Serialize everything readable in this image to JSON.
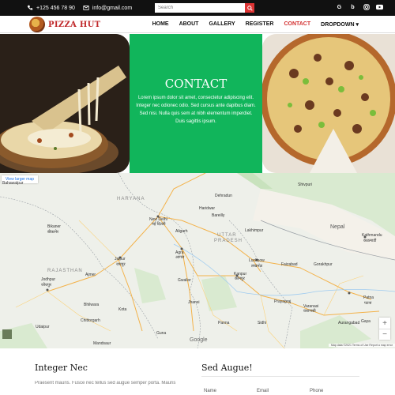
{
  "topbar": {
    "phone": "+125 456 78 90",
    "email": "info@gmail.com",
    "search_placeholder": "Search",
    "social": [
      "G",
      "b",
      "in",
      "yt"
    ]
  },
  "nav": {
    "brand": "PIZZA HUT",
    "items": [
      {
        "label": "HOME",
        "active": false
      },
      {
        "label": "ABOUT",
        "active": false
      },
      {
        "label": "GALLERY",
        "active": false
      },
      {
        "label": "REGISTER",
        "active": false
      },
      {
        "label": "CONTACT",
        "active": true
      },
      {
        "label": "DROPDOWN",
        "active": false
      }
    ]
  },
  "hero": {
    "title": "CONTACT",
    "text": "Lorem ipsum dolor sit amet, consectetur adipiscing elit. Integer nec odionec odio. Sed cursus ante dapibus diam. Sed nisi. Nulla quis sem at nibh elementum imperdiet. Duis sagittis ipsum."
  },
  "map": {
    "view_larger": "View larger map",
    "attribution": "Map data ©2021  Terms of Use  Report a map error",
    "google": "Google",
    "labels": [
      {
        "text": "Bahawalpur",
        "cls": ""
      },
      {
        "text": "HARYANA",
        "cls": "big"
      },
      {
        "text": "New Delhi",
        "cls": ""
      },
      {
        "text": "नई दिल्ली",
        "cls": ""
      },
      {
        "text": "Haridwar",
        "cls": ""
      },
      {
        "text": "Dehradun",
        "cls": ""
      },
      {
        "text": "Shivpuri",
        "cls": ""
      },
      {
        "text": "Bikaner",
        "cls": ""
      },
      {
        "text": "बीकानेर",
        "cls": ""
      },
      {
        "text": "Aligarh",
        "cls": ""
      },
      {
        "text": "Bareilly",
        "cls": ""
      },
      {
        "text": "UTTAR",
        "cls": "big"
      },
      {
        "text": "PRADESH",
        "cls": "big"
      },
      {
        "text": "Lakhimpur",
        "cls": ""
      },
      {
        "text": "Nepal",
        "cls": "country"
      },
      {
        "text": "Kathmandu",
        "cls": ""
      },
      {
        "text": "काठमाडौं",
        "cls": ""
      },
      {
        "text": "Jaipur",
        "cls": ""
      },
      {
        "text": "जयपुर",
        "cls": ""
      },
      {
        "text": "Agra",
        "cls": ""
      },
      {
        "text": "आगरा",
        "cls": ""
      },
      {
        "text": "Lucknow",
        "cls": ""
      },
      {
        "text": "लखनऊ",
        "cls": ""
      },
      {
        "text": "Faizabad",
        "cls": ""
      },
      {
        "text": "Gorakhpur",
        "cls": ""
      },
      {
        "text": "RAJASTHAN",
        "cls": "big"
      },
      {
        "text": "Ajmer",
        "cls": ""
      },
      {
        "text": "Jodhpur",
        "cls": ""
      },
      {
        "text": "जोधपुर",
        "cls": ""
      },
      {
        "text": "Gwalior",
        "cls": ""
      },
      {
        "text": "Kanpur",
        "cls": ""
      },
      {
        "text": "कानपुर",
        "cls": ""
      },
      {
        "text": "Prayagraj",
        "cls": ""
      },
      {
        "text": "Varanasi",
        "cls": ""
      },
      {
        "text": "वाराणसी",
        "cls": ""
      },
      {
        "text": "Patna",
        "cls": ""
      },
      {
        "text": "पटना",
        "cls": ""
      },
      {
        "text": "Bhilwara",
        "cls": ""
      },
      {
        "text": "Kota",
        "cls": ""
      },
      {
        "text": "Jhansi",
        "cls": ""
      },
      {
        "text": "Udaipur",
        "cls": ""
      },
      {
        "text": "Chittorgarh",
        "cls": ""
      },
      {
        "text": "Gaya",
        "cls": ""
      },
      {
        "text": "Aurangabad",
        "cls": ""
      },
      {
        "text": "Guna",
        "cls": ""
      },
      {
        "text": "Mandsaur",
        "cls": ""
      },
      {
        "text": "Panna",
        "cls": ""
      },
      {
        "text": "Sidhi",
        "cls": ""
      }
    ]
  },
  "bottom": {
    "left_title": "Integer Nec",
    "left_text": "Praesent mauris. Fusce nec tellus sed augue semper porta. Mauris",
    "right_title": "Sed Augue!",
    "fields": [
      "Name",
      "Email",
      "Phone"
    ]
  }
}
